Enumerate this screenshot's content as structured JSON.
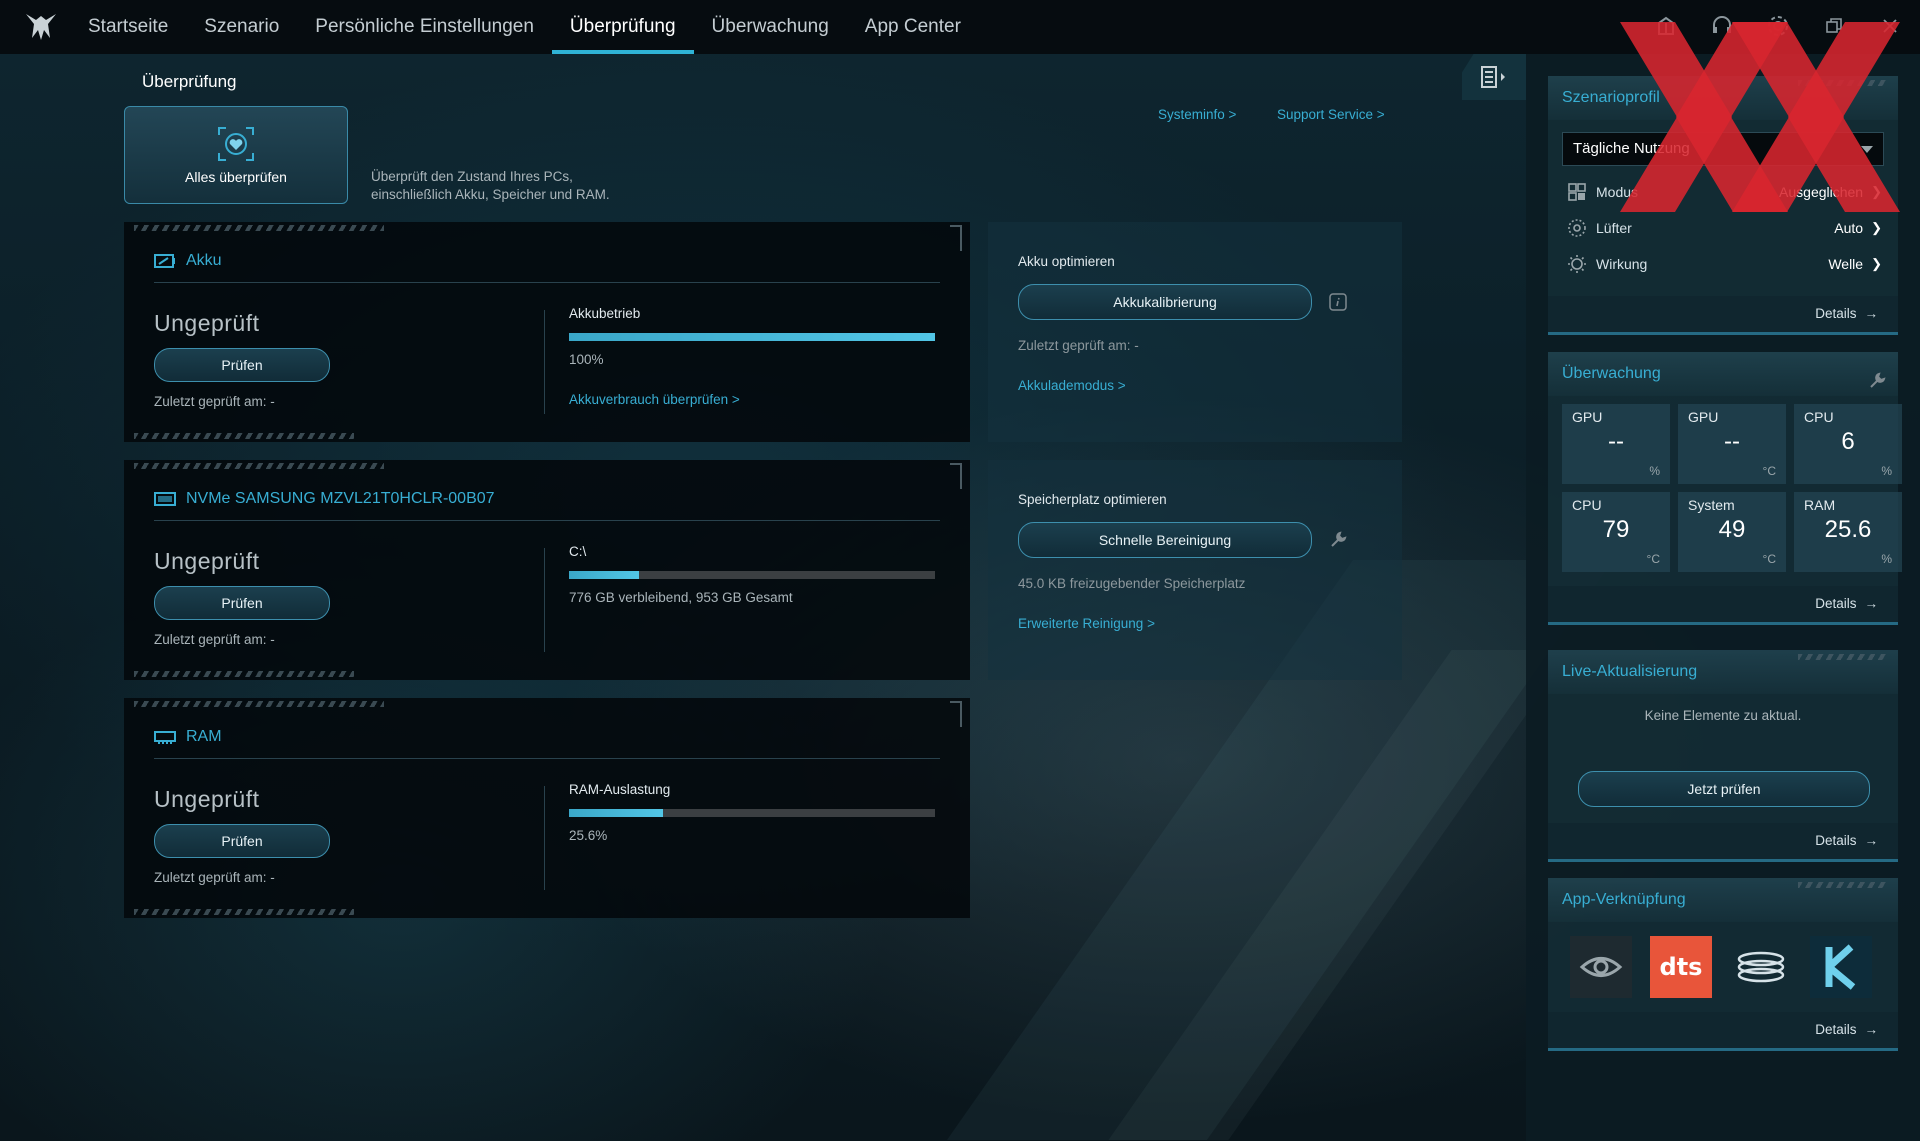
{
  "nav": {
    "tabs": [
      {
        "label": "Startseite",
        "active": false
      },
      {
        "label": "Szenario",
        "active": false
      },
      {
        "label": "Persönliche Einstellungen",
        "active": false
      },
      {
        "label": "Überprüfung",
        "active": true
      },
      {
        "label": "Überwachung",
        "active": false
      },
      {
        "label": "App Center",
        "active": false
      }
    ],
    "icons": [
      "notification-icon",
      "headset-icon",
      "settings-icon",
      "restore-window-icon",
      "close-icon"
    ]
  },
  "main": {
    "title": "Überprüfung",
    "check_all": {
      "label": "Alles überprüfen",
      "description": "Überprüft den Zustand Ihres PCs,\neinschließlich Akku, Speicher und RAM."
    },
    "links": {
      "system_info": "Systeminfo >",
      "support": "Support Service >"
    },
    "cards": [
      {
        "title": "Akku",
        "icon": "battery-icon",
        "status": "Ungeprüft",
        "button": "Prüfen",
        "last_checked": "Zuletzt geprüft am: -",
        "metric_label": "Akkubetrieb",
        "metric_fraction": 1.0,
        "metric_value": "100%",
        "metric_link": "Akkuverbrauch überprüfen >"
      },
      {
        "title": "NVMe SAMSUNG MZVL21T0HCLR-00B07",
        "icon": "ssd-icon",
        "status": "Ungeprüft",
        "button": "Prüfen",
        "last_checked": "Zuletzt geprüft am: -",
        "metric_label": "C:\\",
        "metric_fraction": 0.19,
        "metric_value": "776 GB verbleibend, 953 GB Gesamt",
        "metric_link": ""
      },
      {
        "title": "RAM",
        "icon": "ram-icon",
        "status": "Ungeprüft",
        "button": "Prüfen",
        "last_checked": "Zuletzt geprüft am: -",
        "metric_label": "RAM-Auslastung",
        "metric_fraction": 0.256,
        "metric_value": "25.6%",
        "metric_link": ""
      }
    ],
    "optimize": [
      {
        "title": "Akku optimieren",
        "button": "Akkukalibrierung",
        "icon": "info-icon",
        "info": "Zuletzt geprüft am: -",
        "link": "Akkulademodus >"
      },
      {
        "title": "Speicherplatz optimieren",
        "button": "Schnelle Bereinigung",
        "icon": "wrench-icon",
        "info": "45.0 KB freizugebender Speicherplatz",
        "link": "Erweiterte Reinigung >"
      }
    ]
  },
  "sidebar": {
    "scenario": {
      "title": "Szenarioprofil",
      "selected": "Tägliche Nutzung",
      "rows": [
        {
          "icon": "mode-grid-icon",
          "label": "Modus",
          "value": "Ausgeglichen"
        },
        {
          "icon": "fan-icon",
          "label": "Lüfter",
          "value": "Auto"
        },
        {
          "icon": "light-effect-icon",
          "label": "Wirkung",
          "value": "Welle"
        }
      ],
      "details": "Details"
    },
    "monitoring": {
      "title": "Überwachung",
      "tiles": [
        {
          "name": "GPU",
          "value": "--",
          "unit": "%"
        },
        {
          "name": "GPU",
          "value": "--",
          "unit": "°C"
        },
        {
          "name": "CPU",
          "value": "6",
          "unit": "%"
        },
        {
          "name": "CPU",
          "value": "79",
          "unit": "°C"
        },
        {
          "name": "System",
          "value": "49",
          "unit": "°C"
        },
        {
          "name": "RAM",
          "value": "25.6",
          "unit": "%"
        }
      ],
      "details": "Details"
    },
    "live": {
      "title": "Live-Aktualisierung",
      "message": "Keine Elemente zu aktual.",
      "button": "Jetzt prüfen",
      "details": "Details"
    },
    "apps": {
      "title": "App-Verknüpfung",
      "items": [
        "nvidia-app-icon",
        "dts-app-icon",
        "audio-app-icon",
        "killer-app-icon"
      ],
      "dts_text": "dts",
      "details": "Details"
    }
  },
  "colors": {
    "accent": "#38aed3",
    "bar": "#3aa7c8",
    "dts": "#e8553a",
    "watermark": "#d8262f"
  }
}
